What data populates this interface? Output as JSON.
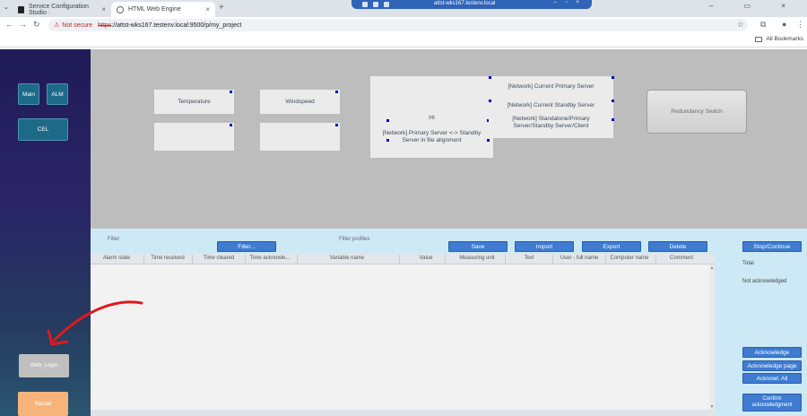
{
  "browser": {
    "tabs": [
      {
        "title": "Service Configuration Studio ·",
        "active": false
      },
      {
        "title": "HTML Web Engine",
        "active": true
      }
    ],
    "remote_title": "attst-wks167.testenv.local",
    "security_label": "Not secure",
    "url_proto": "https",
    "url_rest": "://attst-wks167.testenv.local:9500/p/my_project",
    "bookmarks_label": "All Bookmarks"
  },
  "sidebar": {
    "main_label": "Main",
    "alm_label": "ALM",
    "cel_label": "CEL",
    "web_login_label": "Web_Login",
    "reload_label": "Reload"
  },
  "canvas": {
    "temperature_label": "Temperature",
    "windspeed_label": "Windspeed",
    "hi_label": "HI",
    "primary_standby_label": "[Network] Primary Server <-> Standby Server in file alignment",
    "current_primary_label": "[Network] Current Primary Server",
    "current_standby_label": "[Network] Current Standby Server",
    "standalone_label": "[Network] Standalone/Primary Server/Standby Server/Client",
    "redundancy_label": "Redundancy Switch"
  },
  "alarm": {
    "filter_label": "Filter",
    "filter_button": "Filter...",
    "filter_profiles_label": "Filter profiles",
    "save": "Save",
    "import": "Import",
    "export": "Export",
    "delete": "Delete",
    "stop_continue": "Stop/Continue",
    "columns": [
      "Alarm state",
      "Time received",
      "Time cleared",
      "Time acknowle...",
      "Variable name",
      "Value",
      "Measuring unit",
      "Text",
      "User - full name",
      "Computer name",
      "Comment"
    ],
    "total_label": "Total",
    "not_ack_label": "Not acknowledged",
    "acknowledge": "Acknowledge",
    "acknowledge_page": "Acknowledge page",
    "acknowl_all": "Acknowl. All",
    "confirm_ack": "Confirm acknowledgment"
  },
  "colors": {
    "sidebar_bg": "#1f1b56",
    "button_blue": "#3e7bd1",
    "reload_orange": "#f6b47a",
    "annotation_red": "#e0191e"
  }
}
